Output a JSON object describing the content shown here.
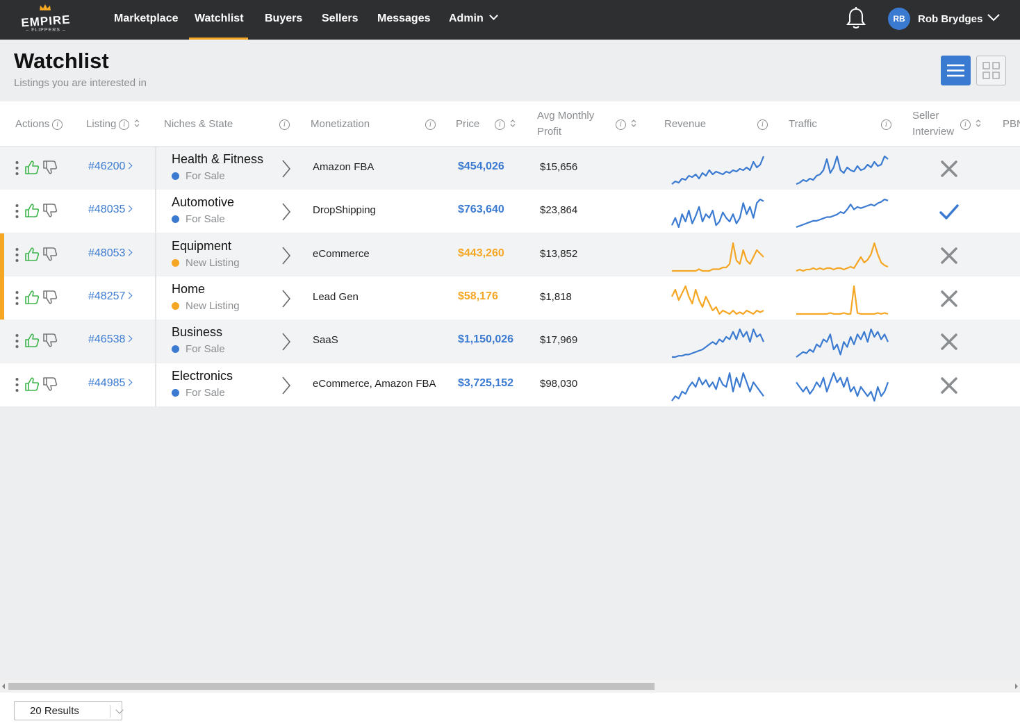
{
  "nav": {
    "logo_text": "EMPIRE",
    "logo_sub": "– FLIPPERS –",
    "items": [
      {
        "label": "Marketplace"
      },
      {
        "label": "Watchlist"
      },
      {
        "label": "Buyers"
      },
      {
        "label": "Sellers"
      },
      {
        "label": "Messages"
      },
      {
        "label": "Admin"
      }
    ],
    "active": "Watchlist",
    "user_initials": "RB",
    "user_name": "Rob Brydges"
  },
  "header": {
    "title": "Watchlist",
    "subtitle": "Listings you are interested in"
  },
  "table": {
    "columns": [
      {
        "label": "Actions"
      },
      {
        "label": "Listing"
      },
      {
        "label": "Niches & State"
      },
      {
        "label": "Monetization"
      },
      {
        "label": "Price"
      },
      {
        "label": "Avg Monthly Profit"
      },
      {
        "label": "Revenue"
      },
      {
        "label": "Traffic"
      },
      {
        "label": "Seller Interview"
      },
      {
        "label": "PBN"
      }
    ],
    "avg_profit_line1": "Avg Monthly",
    "avg_profit_line2": "Profit",
    "seller_line1": "Seller",
    "seller_line2": "Interview",
    "rows": [
      {
        "id": "#46200",
        "niche": "Health & Fitness",
        "state": "For Sale",
        "monetization": "Amazon FBA",
        "price": "$454,026",
        "profit": "$15,656",
        "seller_interview": false,
        "status_color": "#3b7ad1",
        "revenue": [
          2,
          4,
          3,
          6,
          5,
          8,
          7,
          9,
          6,
          10,
          8,
          12,
          9,
          11,
          10,
          9,
          11,
          10,
          12,
          11,
          13,
          12,
          14,
          12,
          18,
          14,
          16,
          22
        ],
        "traffic": [
          2,
          3,
          5,
          4,
          6,
          5,
          8,
          9,
          12,
          20,
          10,
          14,
          22,
          12,
          10,
          14,
          12,
          11,
          15,
          12,
          13,
          16,
          14,
          18,
          15,
          16,
          22,
          20
        ]
      },
      {
        "id": "#48035",
        "niche": "Automotive",
        "state": "For Sale",
        "monetization": "DropShipping",
        "price": "$763,640",
        "profit": "$23,864",
        "seller_interview": true,
        "status_color": "#3b7ad1",
        "revenue": [
          8,
          12,
          7,
          14,
          10,
          16,
          9,
          13,
          18,
          10,
          14,
          12,
          16,
          8,
          10,
          15,
          12,
          10,
          14,
          9,
          12,
          20,
          14,
          18,
          12,
          20,
          22,
          21
        ],
        "traffic": [
          2,
          3,
          4,
          5,
          6,
          7,
          7,
          8,
          9,
          10,
          10,
          11,
          12,
          14,
          13,
          16,
          20,
          16,
          18,
          17,
          18,
          19,
          20,
          19,
          21,
          22,
          24,
          23
        ]
      },
      {
        "id": "#48053",
        "niche": "Equipment",
        "state": "New Listing",
        "monetization": "eCommerce",
        "price": "$443,260",
        "profit": "$13,852",
        "seller_interview": false,
        "status_color": "#f5a623",
        "revenue": [
          2,
          2,
          2,
          2,
          2,
          2,
          2,
          2,
          3,
          2,
          2,
          2,
          3,
          3,
          3,
          4,
          4,
          6,
          18,
          8,
          6,
          14,
          8,
          6,
          10,
          14,
          12,
          10
        ],
        "traffic": [
          2,
          3,
          2,
          3,
          3,
          4,
          3,
          4,
          3,
          4,
          4,
          3,
          4,
          4,
          3,
          4,
          5,
          4,
          8,
          12,
          8,
          10,
          14,
          22,
          14,
          8,
          6,
          5
        ]
      },
      {
        "id": "#48257",
        "niche": "Home",
        "state": "New Listing",
        "monetization": "Lead Gen",
        "price": "$58,176",
        "profit": "$1,818",
        "seller_interview": false,
        "status_color": "#f5a623",
        "revenue": [
          14,
          18,
          12,
          16,
          20,
          14,
          10,
          18,
          12,
          8,
          14,
          10,
          6,
          8,
          4,
          6,
          5,
          4,
          6,
          4,
          5,
          4,
          6,
          5,
          4,
          6,
          5,
          6
        ],
        "traffic": [
          2,
          2,
          2,
          2,
          2,
          2,
          2,
          2,
          2,
          2,
          3,
          2,
          2,
          2,
          3,
          2,
          2,
          28,
          3,
          2,
          2,
          2,
          2,
          2,
          3,
          2,
          3,
          2
        ]
      },
      {
        "id": "#46538",
        "niche": "Business",
        "state": "For Sale",
        "monetization": "SaaS",
        "price": "$1,150,026",
        "profit": "$17,969",
        "seller_interview": false,
        "status_color": "#3b7ad1",
        "revenue": [
          2,
          2,
          3,
          3,
          4,
          4,
          5,
          6,
          7,
          8,
          10,
          12,
          14,
          12,
          16,
          14,
          18,
          16,
          22,
          16,
          24,
          18,
          22,
          14,
          24,
          18,
          20,
          14
        ],
        "traffic": [
          2,
          4,
          6,
          5,
          8,
          6,
          12,
          10,
          16,
          14,
          20,
          8,
          12,
          4,
          14,
          10,
          18,
          12,
          20,
          16,
          22,
          14,
          24,
          18,
          22,
          16,
          20,
          14
        ]
      },
      {
        "id": "#44985",
        "niche": "Electronics",
        "state": "For Sale",
        "monetization": "eCommerce, Amazon FBA",
        "price": "$3,725,152",
        "profit": "$98,030",
        "seller_interview": false,
        "status_color": "#3b7ad1",
        "revenue": [
          6,
          8,
          7,
          10,
          9,
          12,
          14,
          12,
          16,
          13,
          15,
          12,
          14,
          11,
          16,
          13,
          12,
          18,
          10,
          16,
          12,
          18,
          14,
          10,
          14,
          12,
          10,
          8
        ],
        "traffic": [
          14,
          12,
          10,
          12,
          9,
          11,
          14,
          12,
          16,
          10,
          14,
          18,
          14,
          16,
          12,
          16,
          10,
          12,
          8,
          12,
          10,
          8,
          10,
          6,
          12,
          8,
          10,
          14
        ]
      }
    ]
  },
  "footer": {
    "results_label": "20 Results"
  },
  "colors": {
    "accent": "#3b7ad1",
    "new_listing": "#f5a623",
    "nav_bg": "#2e2f31",
    "thumb_up": "#3bb54a",
    "cross": "#8a8d90"
  },
  "icons": [
    "crown-icon",
    "bell-icon",
    "chevron-down-icon",
    "list-view-icon",
    "grid-view-icon",
    "info-icon",
    "sort-icon",
    "more-vertical-icon",
    "thumbs-up-icon",
    "thumbs-down-icon",
    "chevron-right-icon",
    "check-icon",
    "close-icon"
  ]
}
